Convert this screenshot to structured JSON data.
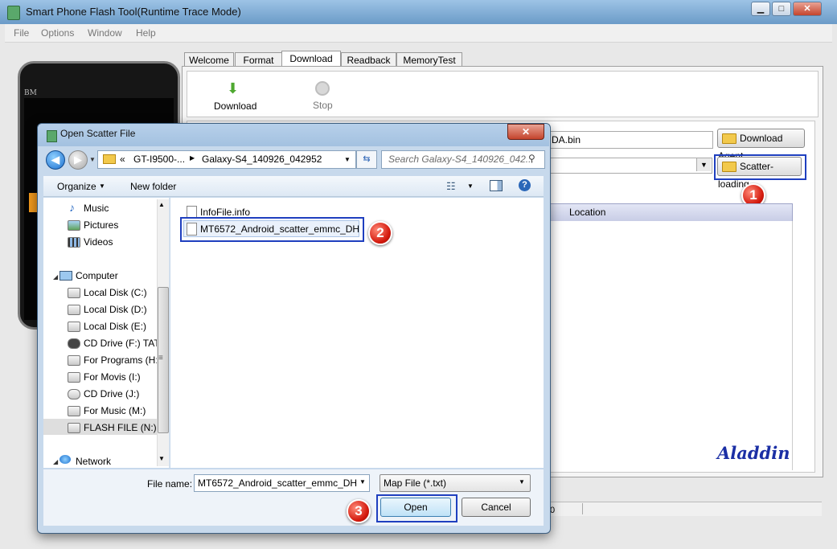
{
  "main_window": {
    "title": "Smart Phone Flash Tool(Runtime Trace Mode)",
    "controls": {
      "minimize": "▁",
      "maximize": "□",
      "close": "✕"
    }
  },
  "menubar": [
    "File",
    "Options",
    "Window",
    "Help"
  ],
  "phone_text": "BM",
  "tabs": [
    {
      "label": "Welcome",
      "active": false
    },
    {
      "label": "Format",
      "active": false
    },
    {
      "label": "Download",
      "active": true
    },
    {
      "label": "Readback",
      "active": false
    },
    {
      "label": "MemoryTest",
      "active": false
    }
  ],
  "toolbar": {
    "download_label": "Download",
    "stop_label": "Stop",
    "download_icon": "⬇"
  },
  "download_panel": {
    "download_agent_path": "DA.bin",
    "download_agent_button": "Download Agent",
    "scatter_button": "Scatter-loading",
    "location_header": "Location"
  },
  "watermark": "Aladdin",
  "status_bar": {
    "cell1": "0"
  },
  "badges": [
    "1",
    "2",
    "3"
  ],
  "dialog": {
    "title": "Open Scatter File",
    "close": "✕",
    "address": {
      "sep": "«",
      "crumb1": "GT-I9500-...",
      "crumb2": "Galaxy-S4_140926_042952"
    },
    "search_placeholder": "Search Galaxy-S4_140926_042...",
    "commandbar": {
      "organize": "Organize",
      "new_folder": "New folder",
      "help": "?"
    },
    "nav_items": [
      {
        "label": "Music",
        "icon": "music-icon"
      },
      {
        "label": "Pictures",
        "icon": "pictures-icon"
      },
      {
        "label": "Videos",
        "icon": "videos-icon"
      },
      {
        "label": "Computer",
        "icon": "computer-icon"
      },
      {
        "label": "Local Disk (C:)",
        "icon": "drive-icon"
      },
      {
        "label": "Local Disk (D:)",
        "icon": "drive-icon"
      },
      {
        "label": "Local Disk (E:)",
        "icon": "drive-icon"
      },
      {
        "label": "CD Drive (F:) TAT",
        "icon": "cd-drive-icon"
      },
      {
        "label": "For Programs (H:",
        "icon": "drive-icon"
      },
      {
        "label": "For Movis (I:)",
        "icon": "drive-icon"
      },
      {
        "label": "CD Drive (J:)",
        "icon": "cd-drive-icon"
      },
      {
        "label": "For Music (M:)",
        "icon": "drive-icon"
      },
      {
        "label": "FLASH FILE (N:)",
        "icon": "drive-icon"
      },
      {
        "label": "Network",
        "icon": "network-icon"
      }
    ],
    "files": [
      "InfoFile.info",
      "MT6572_Android_scatter_emmc_DH"
    ],
    "file_name_label": "File name:",
    "file_name_value": "MT6572_Android_scatter_emmc_DH",
    "file_type_value": "Map File (*.txt)",
    "open_button": "Open",
    "cancel_button": "Cancel"
  },
  "colors": {
    "highlight": "#1f3fbf",
    "badge": "#d3180c",
    "watermark": "#1b2fa5"
  }
}
